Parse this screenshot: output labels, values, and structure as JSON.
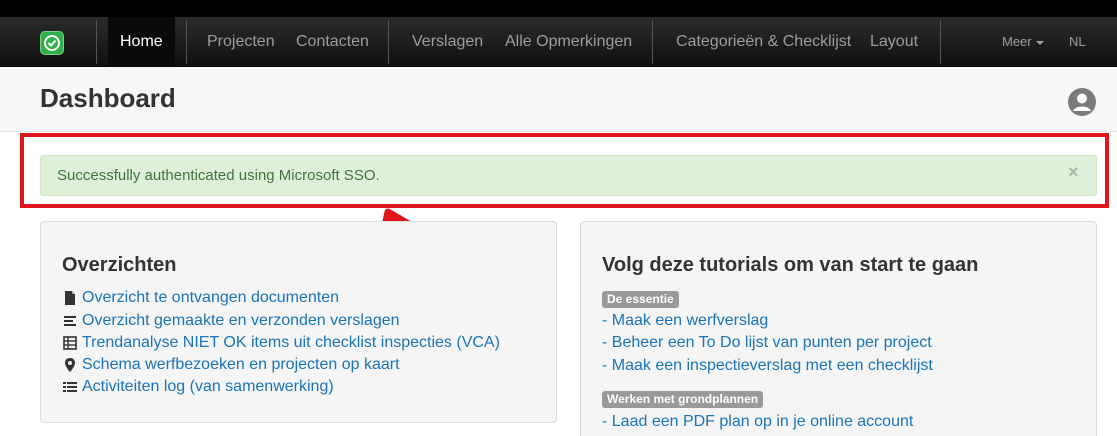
{
  "navbar": {
    "items": [
      {
        "label": "Home"
      },
      {
        "label": "Projecten"
      },
      {
        "label": "Contacten"
      },
      {
        "label": "Verslagen"
      },
      {
        "label": "Alle Opmerkingen"
      },
      {
        "label": "Categorieën & Checklijst"
      },
      {
        "label": "Layout"
      }
    ],
    "more_label": "Meer",
    "language": "NL"
  },
  "header": {
    "title": "Dashboard"
  },
  "alert": {
    "message": "Successfully authenticated using Microsoft SSO.",
    "close": "×"
  },
  "overview": {
    "title": "Overzichten",
    "links": [
      {
        "label": "Overzicht te ontvangen documenten",
        "icon": "file-icon"
      },
      {
        "label": "Overzicht gemaakte en verzonden verslagen",
        "icon": "align-left-icon"
      },
      {
        "label": "Trendanalyse NIET OK items uit checklist inspecties (VCA)",
        "icon": "table-icon"
      },
      {
        "label": "Schema werfbezoeken en projecten op kaart",
        "icon": "map-marker-icon"
      },
      {
        "label": "Activiteiten log (van samenwerking)",
        "icon": "list-icon"
      }
    ]
  },
  "tutorials": {
    "title": "Volg deze tutorials om van start te gaan",
    "groups": [
      {
        "badge": "De essentie",
        "links": [
          "- Maak een werfverslag",
          "- Beheer een To Do lijst van punten per project",
          "- Maak een inspectieverslag met een checklijst"
        ]
      },
      {
        "badge": "Werken met grondplannen",
        "links": [
          "- Laad een PDF plan op in je online account"
        ]
      }
    ]
  },
  "colors": {
    "highlight": "#e0161d",
    "alert_bg": "#dff0d8",
    "alert_text": "#3c763d",
    "link": "#1a74b8",
    "logo": "#2fb04a"
  }
}
